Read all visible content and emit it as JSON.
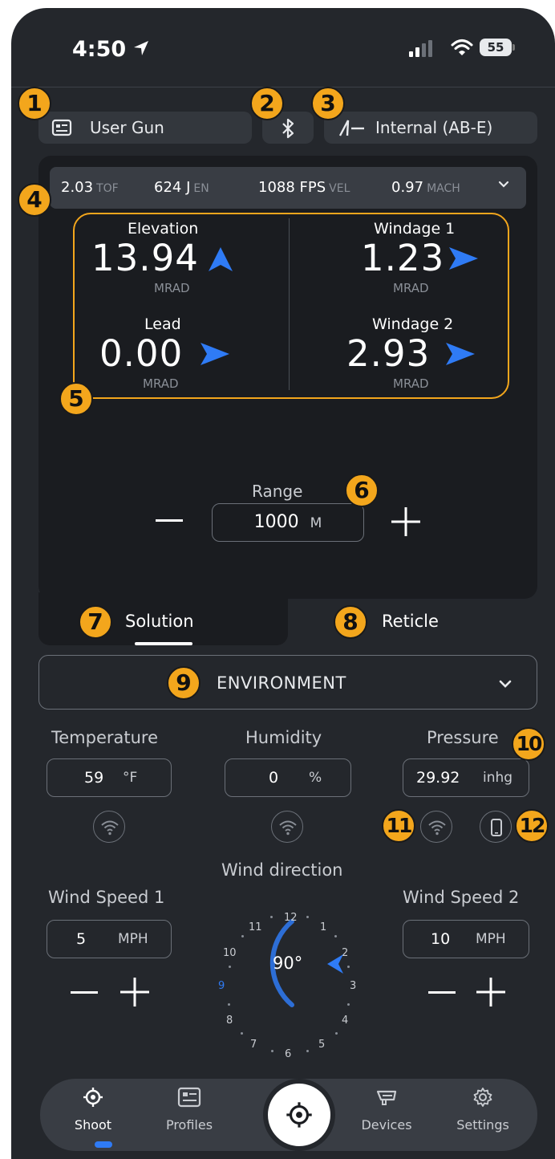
{
  "status": {
    "time": "4:50",
    "battery": "55"
  },
  "top_row": {
    "gun": "User Gun",
    "engine": "Internal (AB-E)"
  },
  "stats": [
    {
      "value": "2.03",
      "unit": "TOF"
    },
    {
      "value": "624 J",
      "unit": "EN"
    },
    {
      "value": "1088 FPS",
      "unit": "VEL"
    },
    {
      "value": "0.97",
      "unit": "MACH"
    }
  ],
  "solution": {
    "elevation": {
      "label": "Elevation",
      "value": "13.94",
      "unit": "MRAD",
      "arrow": "up"
    },
    "windage1": {
      "label": "Windage 1",
      "value": "1.23",
      "unit": "MRAD",
      "arrow": "right"
    },
    "lead": {
      "label": "Lead",
      "value": "0.00",
      "unit": "MRAD",
      "arrow": "right"
    },
    "windage2": {
      "label": "Windage 2",
      "value": "2.93",
      "unit": "MRAD",
      "arrow": "right"
    }
  },
  "range": {
    "label": "Range",
    "value": "1000",
    "unit": "M"
  },
  "tabs": {
    "solution": "Solution",
    "reticle": "Reticle",
    "active": "Solution"
  },
  "environment": {
    "title": "ENVIRONMENT",
    "temperature": {
      "label": "Temperature",
      "value": "59",
      "unit": "°F"
    },
    "humidity": {
      "label": "Humidity",
      "value": "0",
      "unit": "%"
    },
    "pressure": {
      "label": "Pressure",
      "value": "29.92",
      "unit": "inhg"
    }
  },
  "wind": {
    "direction_label": "Wind direction",
    "direction_value": "90°",
    "clock_numbers": [
      "12",
      "1",
      "2",
      "3",
      "4",
      "5",
      "6",
      "7",
      "8",
      "9",
      "10",
      "11"
    ],
    "speed1": {
      "label": "Wind Speed 1",
      "value": "5",
      "unit": "MPH"
    },
    "speed2": {
      "label": "Wind Speed 2",
      "value": "10",
      "unit": "MPH"
    }
  },
  "badges": [
    "1",
    "2",
    "3",
    "4",
    "5",
    "6",
    "7",
    "8",
    "9",
    "10",
    "11",
    "12"
  ],
  "nav": {
    "shoot": "Shoot",
    "profiles": "Profiles",
    "devices": "Devices",
    "settings": "Settings",
    "active": "Shoot"
  },
  "colors": {
    "accent": "#2f7bf5",
    "badge": "#f3a61c",
    "background": "#24272c",
    "card": "#1a1c20"
  },
  "icons": [
    "location-arrow-icon",
    "signal-icon",
    "wifi-icon",
    "profile-card-icon",
    "bluetooth-icon",
    "engine-icon",
    "chevron-down-icon",
    "arrow-up-icon",
    "arrow-right-icon",
    "minus-icon",
    "plus-icon",
    "phone-icon",
    "target-icon",
    "gear-icon",
    "devices-icon"
  ]
}
